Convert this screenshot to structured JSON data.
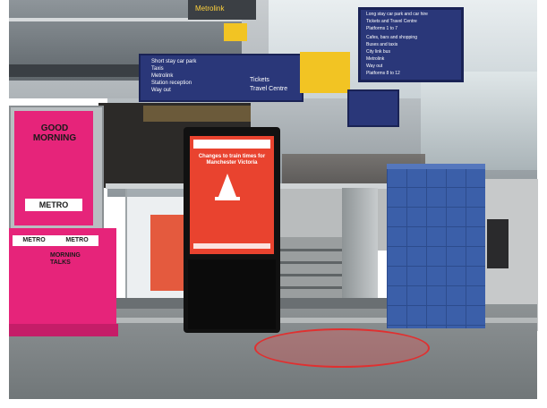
{
  "signs": {
    "metrolink": "Metrolink",
    "left_sign_lines": [
      "Short stay car park",
      "Taxis",
      "Metrolink",
      "Station reception",
      "Way out"
    ],
    "left_sign_right": [
      "Tickets",
      "Travel Centre"
    ],
    "right_sign_lines": [
      "Long stay car park and car hire",
      "Tickets and Travel Centre",
      "Platforms 1 to 7",
      "Cafes, bars and shopping",
      "Buses and taxis",
      "City link bus",
      "Metrolink",
      "Way out",
      "Platforms 8 to 12"
    ]
  },
  "poster": {
    "title": "GOOD MORNING",
    "brand": "METRO"
  },
  "stand": {
    "label_left": "METRO",
    "label_right": "METRO",
    "text": "MORNING TALKS"
  },
  "kiosk": {
    "title": "Changes to train times for Manchester Victoria"
  },
  "colors": {
    "poster_pink": "#e6247a",
    "sign_blue": "#2a3779",
    "sign_yellow": "#f2c423",
    "kiosk_red": "#e9432f",
    "pillar_blue": "#3b5fa9",
    "highlight_red": "#e03030"
  }
}
